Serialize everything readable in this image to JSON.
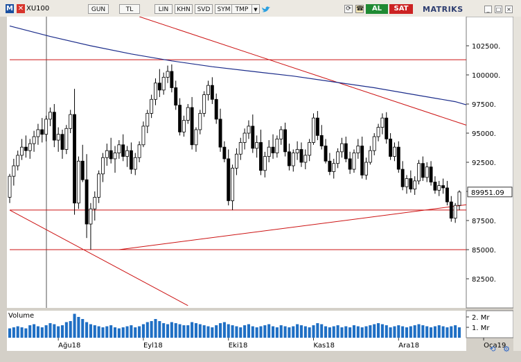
{
  "toolbar": {
    "logo": "M",
    "close_glyph": "✕",
    "symbol": "XU100",
    "buttons": [
      "GUN",
      "TL",
      "LIN",
      "KHN",
      "SVD",
      "SYM",
      "TMP"
    ],
    "dropdown_glyph": "▼",
    "buy_label": "AL",
    "sell_label": "SAT",
    "brand": "MATRIKS",
    "icons": [
      "twitter-icon",
      "refresh-icon",
      "phone-icon",
      "minimize-icon",
      "maximize-icon",
      "close-icon"
    ]
  },
  "colors": {
    "bull_body": "#ffffff",
    "bear_body": "#000000",
    "ma_line": "#1a2b8a",
    "trend_line": "#cc1111",
    "chart_bg": "#ffffff",
    "price_label_bg": "#ffffff"
  },
  "chart_data": {
    "type": "candlestick",
    "symbol": "XU100",
    "ylim": [
      80000,
      105000
    ],
    "y_ticks": [
      82500,
      85000,
      87500,
      90000,
      92500,
      95000,
      97500,
      100000,
      102500
    ],
    "y_tick_labels": [
      "82500.",
      "85000.",
      "87500.",
      "",
      "92500.",
      "95000.",
      "97500.",
      "100000.",
      "102500."
    ],
    "last_price_label": "89951.09",
    "last_price": 89951.09,
    "x_labels": [
      "Ağu18",
      "Eyl18",
      "Eki18",
      "Kas18",
      "Ara18",
      "Oca19"
    ],
    "x_label_index": [
      12,
      33,
      54,
      75,
      96,
      117
    ],
    "ohlc": [
      [
        89500,
        91500,
        89000,
        91300
      ],
      [
        91300,
        92800,
        90500,
        92200
      ],
      [
        92200,
        93500,
        91800,
        93100
      ],
      [
        93100,
        94500,
        92700,
        93800
      ],
      [
        93800,
        94800,
        92900,
        93500
      ],
      [
        93500,
        94500,
        92800,
        94100
      ],
      [
        94100,
        95200,
        93400,
        94700
      ],
      [
        94700,
        95800,
        94000,
        95300
      ],
      [
        95300,
        96300,
        94200,
        94900
      ],
      [
        94900,
        96500,
        94300,
        96200
      ],
      [
        96200,
        97200,
        95600,
        96800
      ],
      [
        96800,
        97500,
        93800,
        94400
      ],
      [
        94400,
        95500,
        93400,
        94900
      ],
      [
        94900,
        95300,
        92800,
        93600
      ],
      [
        93600,
        95700,
        93200,
        95400
      ],
      [
        95400,
        97000,
        95000,
        96600
      ],
      [
        96600,
        98800,
        88000,
        89000
      ],
      [
        89000,
        93000,
        88500,
        92600
      ],
      [
        92600,
        94000,
        90800,
        91000
      ],
      [
        91000,
        93200,
        86000,
        87200
      ],
      [
        87200,
        89000,
        85000,
        88500
      ],
      [
        88500,
        90000,
        87500,
        89500
      ],
      [
        89500,
        91800,
        89000,
        91500
      ],
      [
        91500,
        93300,
        90800,
        92900
      ],
      [
        92900,
        94100,
        92200,
        93500
      ],
      [
        93500,
        94600,
        92400,
        92800
      ],
      [
        92800,
        93900,
        91600,
        93300
      ],
      [
        93300,
        94400,
        92800,
        94000
      ],
      [
        94000,
        94900,
        92600,
        93000
      ],
      [
        93000,
        93900,
        92100,
        93500
      ],
      [
        93500,
        94200,
        91500,
        91900
      ],
      [
        91900,
        93300,
        91400,
        92900
      ],
      [
        92900,
        94300,
        92500,
        94000
      ],
      [
        94000,
        96000,
        93800,
        95600
      ],
      [
        95600,
        97000,
        95000,
        96700
      ],
      [
        96700,
        98300,
        96300,
        97900
      ],
      [
        97900,
        99700,
        97400,
        99300
      ],
      [
        99300,
        100500,
        98100,
        98700
      ],
      [
        98700,
        100200,
        98300,
        99800
      ],
      [
        99800,
        100800,
        99300,
        100300
      ],
      [
        100300,
        100900,
        98500,
        98900
      ],
      [
        98900,
        99500,
        97000,
        97400
      ],
      [
        97400,
        98000,
        94800,
        95100
      ],
      [
        95100,
        96500,
        94700,
        96100
      ],
      [
        96100,
        97500,
        95800,
        97200
      ],
      [
        97200,
        98100,
        93600,
        94000
      ],
      [
        94000,
        95500,
        93400,
        95300
      ],
      [
        95300,
        97000,
        94900,
        96700
      ],
      [
        96700,
        98600,
        96400,
        98300
      ],
      [
        98300,
        99500,
        97800,
        99100
      ],
      [
        99100,
        99800,
        97500,
        97900
      ],
      [
        97900,
        98400,
        95800,
        96200
      ],
      [
        96200,
        97100,
        93400,
        93800
      ],
      [
        93800,
        94300,
        92500,
        92800
      ],
      [
        92800,
        93600,
        88800,
        89200
      ],
      [
        89200,
        92300,
        88400,
        92000
      ],
      [
        92000,
        93700,
        91400,
        93200
      ],
      [
        93200,
        94600,
        92700,
        94200
      ],
      [
        94200,
        95400,
        93600,
        95000
      ],
      [
        95000,
        96100,
        94500,
        95600
      ],
      [
        95600,
        96600,
        93300,
        93700
      ],
      [
        93700,
        94800,
        92900,
        94200
      ],
      [
        94200,
        95300,
        91400,
        91800
      ],
      [
        91800,
        93400,
        91200,
        93000
      ],
      [
        93000,
        94400,
        92500,
        93800
      ],
      [
        93800,
        94900,
        92800,
        93300
      ],
      [
        93300,
        94800,
        92900,
        94500
      ],
      [
        94500,
        95600,
        94000,
        95300
      ],
      [
        95300,
        95900,
        93000,
        93400
      ],
      [
        93400,
        94100,
        91800,
        92200
      ],
      [
        92200,
        93600,
        91700,
        93300
      ],
      [
        93300,
        94300,
        92700,
        93600
      ],
      [
        93600,
        94200,
        92100,
        92500
      ],
      [
        92500,
        93600,
        91900,
        93100
      ],
      [
        93100,
        94500,
        92600,
        94200
      ],
      [
        94200,
        96700,
        94000,
        96300
      ],
      [
        96300,
        96900,
        94400,
        94800
      ],
      [
        94800,
        95700,
        93600,
        93900
      ],
      [
        93900,
        94500,
        92400,
        92600
      ],
      [
        92600,
        93300,
        91400,
        91700
      ],
      [
        91700,
        92800,
        91100,
        92400
      ],
      [
        92400,
        93700,
        92000,
        93400
      ],
      [
        93400,
        94600,
        92900,
        94100
      ],
      [
        94100,
        94700,
        92500,
        92800
      ],
      [
        92800,
        93400,
        91500,
        91900
      ],
      [
        91900,
        93600,
        91600,
        93300
      ],
      [
        93300,
        94500,
        92800,
        93900
      ],
      [
        93900,
        94700,
        91100,
        91400
      ],
      [
        91400,
        92900,
        91000,
        92500
      ],
      [
        92500,
        93900,
        92300,
        93500
      ],
      [
        93500,
        95000,
        93100,
        94700
      ],
      [
        94700,
        95800,
        94300,
        95500
      ],
      [
        95500,
        96700,
        94900,
        96300
      ],
      [
        96300,
        96800,
        94100,
        94500
      ],
      [
        94500,
        95000,
        92700,
        93000
      ],
      [
        93000,
        94200,
        92600,
        93800
      ],
      [
        93800,
        94300,
        91600,
        91900
      ],
      [
        91900,
        92600,
        90100,
        90400
      ],
      [
        90400,
        91400,
        89800,
        91100
      ],
      [
        91100,
        91800,
        89900,
        90200
      ],
      [
        90200,
        91300,
        89700,
        90900
      ],
      [
        90900,
        92700,
        90600,
        92400
      ],
      [
        92400,
        93000,
        90900,
        91200
      ],
      [
        91200,
        92500,
        90800,
        92100
      ],
      [
        92100,
        92600,
        90500,
        90800
      ],
      [
        90800,
        91300,
        89800,
        90100
      ],
      [
        90100,
        90900,
        89600,
        90500
      ],
      [
        90500,
        91100,
        89800,
        90300
      ],
      [
        90300,
        90900,
        88800,
        89100
      ],
      [
        89100,
        89600,
        87400,
        87700
      ],
      [
        87700,
        89000,
        87300,
        88800
      ],
      [
        88800,
        90100,
        88400,
        89951
      ]
    ],
    "moving_average": [
      [
        0,
        104200
      ],
      [
        10,
        103300
      ],
      [
        20,
        102500
      ],
      [
        30,
        101800
      ],
      [
        40,
        101200
      ],
      [
        50,
        100700
      ],
      [
        60,
        100300
      ],
      [
        70,
        99900
      ],
      [
        80,
        99400
      ],
      [
        90,
        98900
      ],
      [
        100,
        98300
      ],
      [
        110,
        97700
      ],
      [
        119,
        96800
      ]
    ],
    "trend_lines": [
      {
        "from": [
          0,
          88400
        ],
        "to": [
          136,
          88400
        ]
      },
      {
        "from": [
          0,
          85000
        ],
        "to": [
          136,
          85000
        ]
      },
      {
        "from": [
          0,
          101300
        ],
        "to": [
          136,
          101300
        ]
      },
      {
        "from": [
          27,
          85000
        ],
        "to": [
          136,
          89900
        ]
      },
      {
        "from": [
          32,
          105000
        ],
        "to": [
          136,
          93000
        ]
      },
      {
        "from": [
          0,
          88400
        ],
        "to": [
          44,
          80200
        ]
      }
    ],
    "volume_label": "Volume",
    "volume_tick_labels": [
      "2. Mr",
      "1. Mr"
    ],
    "volume_ticks": [
      2,
      1
    ],
    "volume": [
      0.9,
      1.0,
      1.1,
      1.0,
      0.9,
      1.2,
      1.3,
      1.1,
      1.0,
      1.2,
      1.4,
      1.3,
      1.1,
      1.2,
      1.5,
      1.6,
      2.3,
      2.0,
      1.8,
      1.5,
      1.3,
      1.2,
      1.1,
      1.0,
      1.1,
      1.2,
      1.0,
      0.9,
      1.0,
      1.1,
      1.2,
      1.0,
      1.1,
      1.3,
      1.5,
      1.6,
      1.8,
      1.6,
      1.4,
      1.3,
      1.5,
      1.4,
      1.3,
      1.2,
      1.2,
      1.5,
      1.4,
      1.3,
      1.2,
      1.1,
      1.0,
      1.2,
      1.4,
      1.5,
      1.3,
      1.2,
      1.1,
      1.0,
      1.2,
      1.3,
      1.1,
      1.0,
      1.1,
      1.2,
      1.3,
      1.1,
      1.0,
      1.2,
      1.1,
      1.0,
      1.1,
      1.3,
      1.2,
      1.1,
      1.0,
      1.2,
      1.4,
      1.3,
      1.1,
      1.0,
      1.1,
      1.2,
      1.0,
      1.1,
      1.0,
      1.2,
      1.1,
      1.0,
      1.1,
      1.2,
      1.3,
      1.4,
      1.3,
      1.2,
      1.0,
      1.1,
      1.2,
      1.1,
      1.0,
      1.1,
      1.2,
      1.3,
      1.2,
      1.1,
      1.0,
      1.1,
      1.2,
      1.1,
      1.0,
      1.1,
      1.2,
      1.0
    ],
    "grid": false,
    "legend": "none"
  }
}
